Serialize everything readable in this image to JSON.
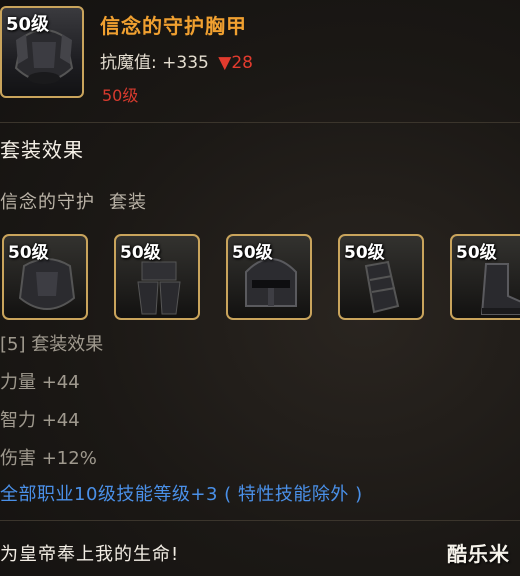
{
  "item": {
    "level_tag": "50级",
    "name": "信念的守护胸甲",
    "stat_label": "抗魔值:",
    "stat_value": "+335",
    "stat_delta": "▼28",
    "required_level": "50级",
    "icon": "chest-armor-icon"
  },
  "set": {
    "section_title": "套装效果",
    "set_name": "信念的守护",
    "set_suffix": "套装",
    "pieces": [
      {
        "level_tag": "50级",
        "icon": "chest-armor-icon"
      },
      {
        "level_tag": "50级",
        "icon": "leg-armor-icon"
      },
      {
        "level_tag": "50级",
        "icon": "helmet-icon"
      },
      {
        "level_tag": "50级",
        "icon": "gauntlet-icon"
      },
      {
        "level_tag": "50级",
        "icon": "boots-icon"
      }
    ],
    "effects_header": "[5] 套装效果",
    "effects": [
      "力量 +44",
      "智力 +44",
      "伤害 +12%"
    ],
    "skill_bonus": "全部职业10级技能等级+3 ( 特性技能除外 )"
  },
  "flavor_text": "为皇帝奉上我的生命!",
  "watermark": "酷乐米",
  "colors": {
    "item_name": "#f0a030",
    "required_level": "#d63a2e",
    "stat_down": "#e23b2e",
    "skill_bonus": "#4a90e8",
    "slot_border": "#c9a45c"
  }
}
